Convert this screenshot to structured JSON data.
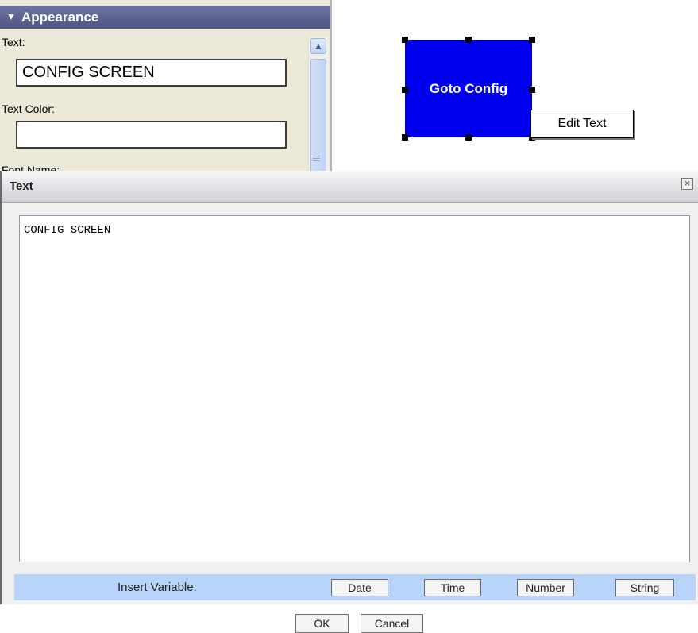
{
  "appearance_panel": {
    "title": "Appearance",
    "text_label": "Text:",
    "text_value": "CONFIG SCREEN",
    "text_color_label": "Text Color:",
    "text_color_value": "",
    "font_name_label": "Font Name:"
  },
  "canvas": {
    "button_label": "Goto Config",
    "context_button": "Edit Text",
    "button_color": "#0000ee"
  },
  "dialog": {
    "title": "Text",
    "content": "CONFIG SCREEN",
    "insert_label": "Insert Variable:",
    "date_label": "Date",
    "time_label": "Time",
    "number_label": "Number",
    "string_label": "String",
    "ok_label": "OK",
    "cancel_label": "Cancel",
    "insert_bar_color": "#b8d4fa"
  }
}
